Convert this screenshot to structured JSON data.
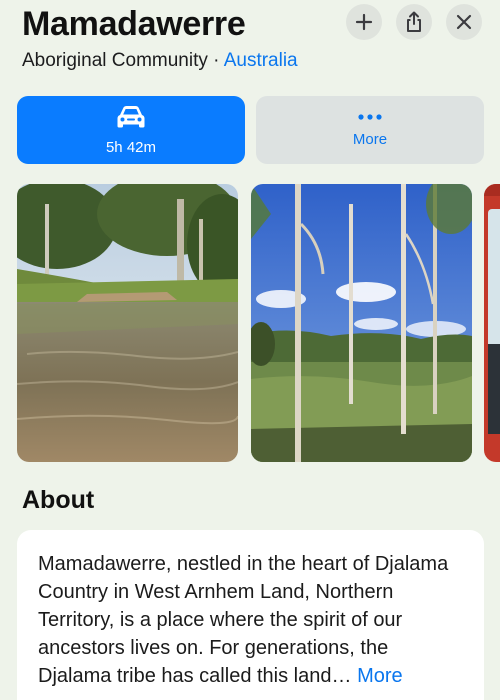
{
  "place": {
    "name": "Mamadawerre",
    "category": "Aboriginal Community",
    "separator": " · ",
    "country": "Australia"
  },
  "top_buttons": [
    {
      "icon": "plus-icon"
    },
    {
      "icon": "share-icon"
    },
    {
      "icon": "close-icon"
    }
  ],
  "actions": {
    "drive": {
      "icon": "car-icon",
      "label": "5h 42m"
    },
    "more": {
      "icon": "ellipsis-icon",
      "label": "More"
    }
  },
  "photos": [
    {
      "name": "creek-photo"
    },
    {
      "name": "wetland-photo"
    },
    {
      "name": "vehicle-photo"
    }
  ],
  "about": {
    "heading": "About",
    "text": "Mamadawerre, nestled in the heart of Djalama Country in West Arnhem Land, Northern Territory, is a place where the spirit of our ancestors lives on. For generations, the Djalama tribe has called this land…",
    "more_label": "More"
  },
  "colors": {
    "accent": "#0a7cff",
    "link": "#0a76ee",
    "background": "#eef3ea"
  }
}
